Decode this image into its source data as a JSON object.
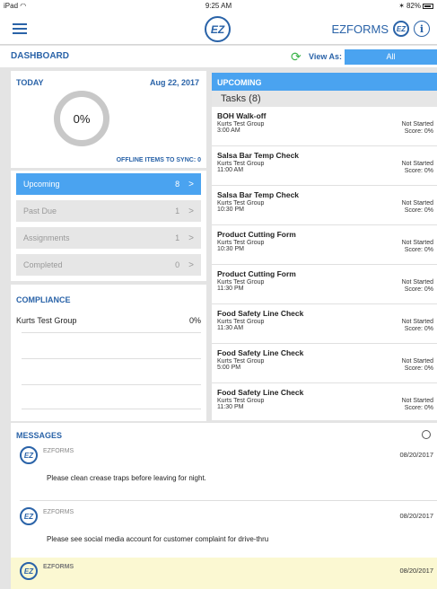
{
  "status": {
    "device": "iPad",
    "wifi_icon": "wifi-icon",
    "time": "9:25 AM",
    "bluetooth_icon": "bluetooth-icon",
    "battery": "82%"
  },
  "nav": {
    "brand": "EZFORMS",
    "logo_text": "EZ"
  },
  "dashboard": {
    "title": "DASHBOARD",
    "view_as_label": "View As:",
    "view_as_value": "All"
  },
  "today": {
    "title": "TODAY",
    "date": "Aug 22, 2017",
    "progress": "0%",
    "offline": "OFFLINE ITEMS TO SYNC: 0",
    "categories": [
      {
        "label": "Upcoming",
        "count": "8"
      },
      {
        "label": "Past Due",
        "count": "1"
      },
      {
        "label": "Assignments",
        "count": "1"
      },
      {
        "label": "Completed",
        "count": "0"
      }
    ]
  },
  "compliance": {
    "title": "COMPLIANCE",
    "group": "Kurts Test Group",
    "value": "0%"
  },
  "upcoming": {
    "title": "UPCOMING",
    "tasks_heading": "Tasks (8)",
    "tasks": [
      {
        "name": "BOH Walk-off",
        "group": "Kurts Test Group",
        "time": "3:00 AM",
        "status": "Not Started",
        "score": "Score: 0%"
      },
      {
        "name": "Salsa Bar Temp Check",
        "group": "Kurts Test Group",
        "time": "11:00 AM",
        "status": "Not Started",
        "score": "Score: 0%"
      },
      {
        "name": "Salsa Bar Temp Check",
        "group": "Kurts Test Group",
        "time": "10:30 PM",
        "status": "Not Started",
        "score": "Score: 0%"
      },
      {
        "name": "Product Cutting Form",
        "group": "Kurts Test Group",
        "time": "10:30 PM",
        "status": "Not Started",
        "score": "Score: 0%"
      },
      {
        "name": "Product Cutting Form",
        "group": "Kurts Test Group",
        "time": "11:30 PM",
        "status": "Not Started",
        "score": "Score: 0%"
      },
      {
        "name": "Food Safety Line Check",
        "group": "Kurts Test Group",
        "time": "11:30 AM",
        "status": "Not Started",
        "score": "Score: 0%"
      },
      {
        "name": "Food Safety Line Check",
        "group": "Kurts Test Group",
        "time": "5:00 PM",
        "status": "Not Started",
        "score": "Score: 0%"
      },
      {
        "name": "Food Safety Line Check",
        "group": "Kurts Test Group",
        "time": "11:30 PM",
        "status": "Not Started",
        "score": "Score: 0%"
      }
    ]
  },
  "messages": {
    "title": "MESSAGES",
    "items": [
      {
        "sender": "EZFORMS",
        "date": "08/20/2017",
        "text": "Please clean crease traps before leaving for night."
      },
      {
        "sender": "EZFORMS",
        "date": "08/20/2017",
        "text": "Please see social media account for customer complaint for drive-thru"
      },
      {
        "sender": "EZFORMS",
        "date": "08/20/2017",
        "text": ""
      }
    ]
  },
  "colors": {
    "accent": "#2a63a8",
    "active": "#4aa3f0",
    "refresh": "#3cb44b",
    "highlight": "#fbf8d2"
  }
}
